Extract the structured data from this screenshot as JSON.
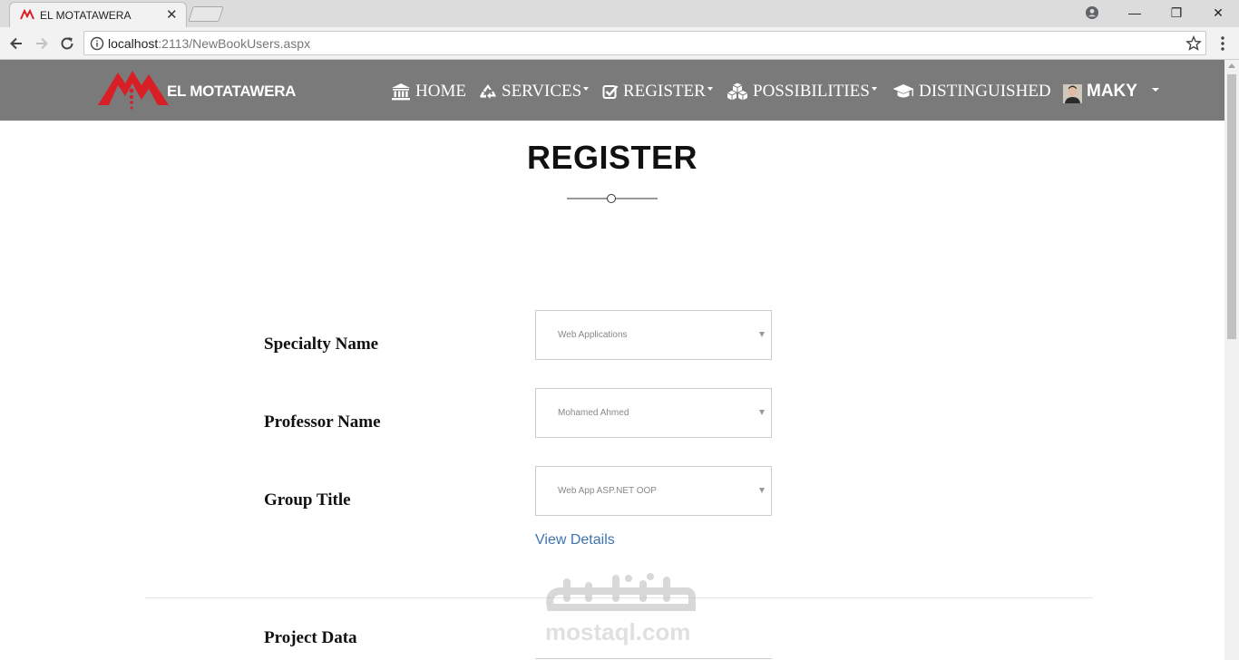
{
  "browser": {
    "tab_title": "EL MOTATAWERA",
    "tab_close": "✕",
    "url_host": "localhost",
    "url_path": ":2113/NewBookUsers.aspx",
    "window_minimize": "—",
    "window_restore": "❐",
    "window_close": "✕"
  },
  "site": {
    "brand": "EL MOTATAWERA",
    "menu": [
      {
        "label": "HOME",
        "icon": "bank-icon",
        "dropdown": false
      },
      {
        "label": "SERVICES",
        "icon": "recycle-icon",
        "dropdown": true
      },
      {
        "label": "REGISTER",
        "icon": "check-square-icon",
        "dropdown": true
      },
      {
        "label": "POSSIBILITIES",
        "icon": "cubes-icon",
        "dropdown": true
      },
      {
        "label": "DISTINGUISHED",
        "icon": "graduation-cap-icon",
        "dropdown": false
      }
    ],
    "user_name": "MAKY"
  },
  "page": {
    "title": "REGISTER",
    "fields": [
      {
        "label": "Specialty Name",
        "value": "Web Applications"
      },
      {
        "label": "Professor Name",
        "value": "Mohamed Ahmed"
      },
      {
        "label": "Group Title",
        "value": "Web App ASP.NET OOP"
      }
    ],
    "view_details": "View Details",
    "section_label": "Project Data"
  },
  "watermark": {
    "arabic": "مستقل",
    "latin": "mostaql.com"
  },
  "colors": {
    "nav_bg": "#7a7a7a",
    "link": "#3d74b0",
    "logo_red": "#d81f26"
  }
}
